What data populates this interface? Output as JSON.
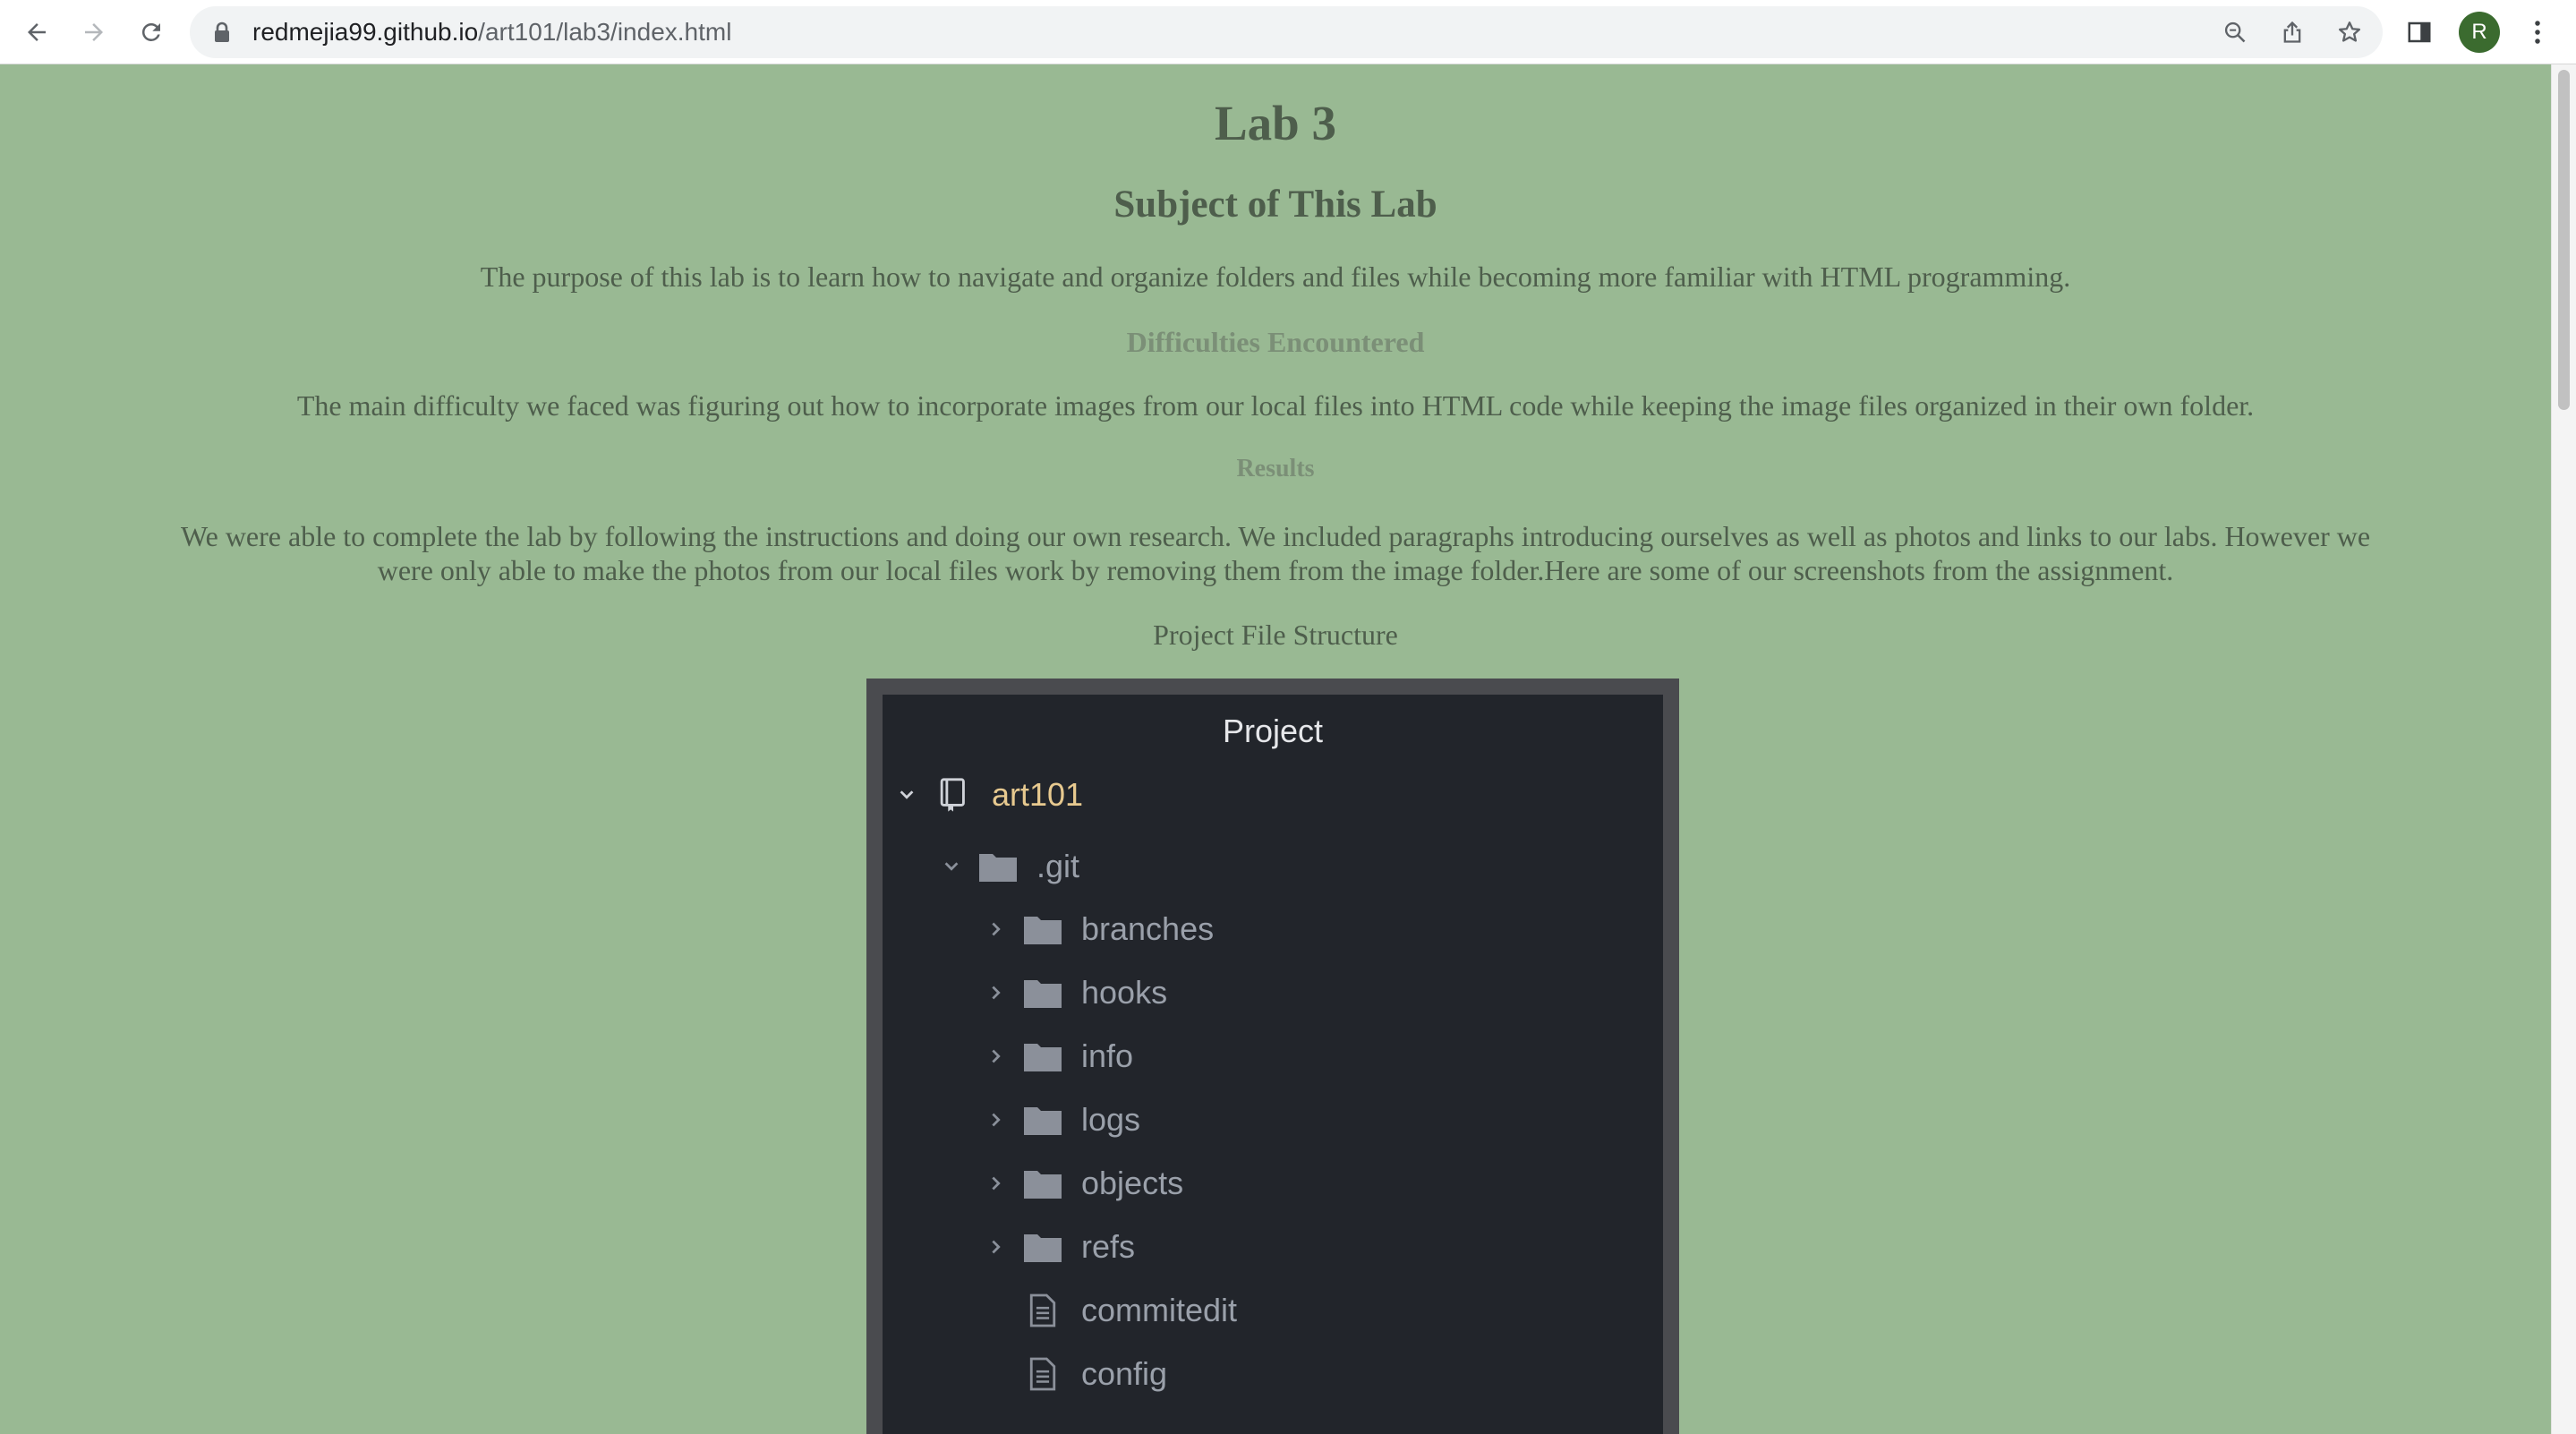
{
  "browser": {
    "url_host": "redmejia99.github.io",
    "url_path": "/art101/lab3/index.html",
    "avatar_initial": "R"
  },
  "page": {
    "title": "Lab 3",
    "subtitle": "Subject of This Lab",
    "purpose": "The purpose of this lab is to learn how to navigate and organize folders and files while becoming more familiar with HTML programming.",
    "difficulties_heading": "Difficulties Encountered",
    "difficulties_text": "The main difficulty we faced was figuring out how to incorporate images from our local files into HTML code while keeping the image files organized in their own folder.",
    "results_heading": "Results",
    "results_text": "We were able to complete the lab by following the instructions and doing our own research. We included paragraphs introducing ourselves as well as photos and links to our labs. However we were only able to make the photos from our local files work by removing them from the image folder.Here are some of our screenshots from the assignment.",
    "caption": "Project File Structure"
  },
  "screenshot": {
    "panel_title": "Project",
    "tree": [
      {
        "label": "art101",
        "icon": "repo-icon",
        "expanded": true
      },
      {
        "label": ".git",
        "icon": "folder-icon",
        "expanded": true
      },
      {
        "label": "branches",
        "icon": "folder-icon",
        "expanded": false
      },
      {
        "label": "hooks",
        "icon": "folder-icon",
        "expanded": false
      },
      {
        "label": "info",
        "icon": "folder-icon",
        "expanded": false
      },
      {
        "label": "logs",
        "icon": "folder-icon",
        "expanded": false
      },
      {
        "label": "objects",
        "icon": "folder-icon",
        "expanded": false
      },
      {
        "label": "refs",
        "icon": "folder-icon",
        "expanded": false
      },
      {
        "label": "commitedit",
        "icon": "file-icon"
      },
      {
        "label": "config",
        "icon": "file-icon"
      }
    ]
  },
  "colors": {
    "page_background": "#99b993",
    "text": "#4e5e4c",
    "muted_heading": "#7b8f77",
    "panel_background": "#22252b",
    "root_label": "#e7c98f"
  }
}
